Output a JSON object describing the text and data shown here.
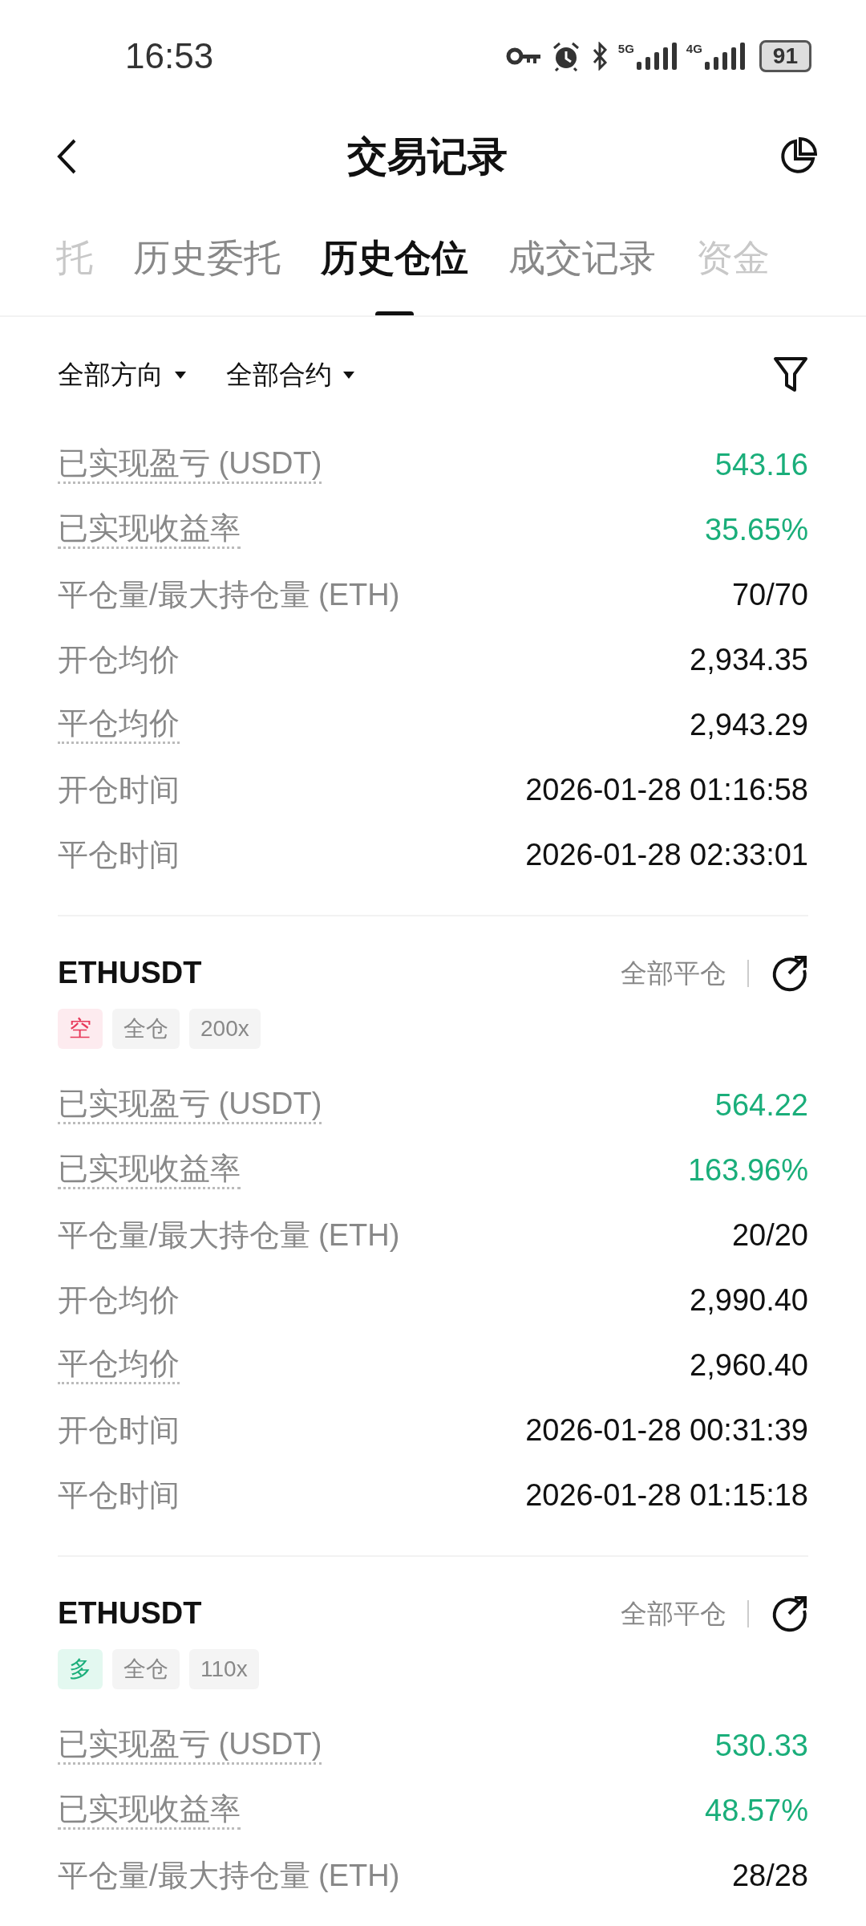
{
  "status_bar": {
    "time": "16:53",
    "network_1": "5G",
    "network_2": "4G",
    "battery": "91"
  },
  "header": {
    "title": "交易记录"
  },
  "tabs": [
    {
      "label": "托",
      "selected": false,
      "partial": true
    },
    {
      "label": "历史委托",
      "selected": false
    },
    {
      "label": "历史仓位",
      "selected": true
    },
    {
      "label": "成交记录",
      "selected": false
    },
    {
      "label": "资金",
      "selected": false,
      "partial": true
    }
  ],
  "filters": [
    {
      "label": "全部方向"
    },
    {
      "label": "全部合约"
    }
  ],
  "positions": [
    {
      "rows": [
        {
          "label": "已实现盈亏 (USDT)",
          "value": "543.16",
          "dotted": true,
          "kind": "gain"
        },
        {
          "label": "已实现收益率",
          "value": "35.65%",
          "dotted": true,
          "kind": "gain"
        },
        {
          "label": "平仓量/最大持仓量 (ETH)",
          "value": "70/70",
          "dotted": false,
          "kind": "plain"
        },
        {
          "label": "开仓均价",
          "value": "2,934.35",
          "dotted": false,
          "kind": "plain"
        },
        {
          "label": "平仓均价",
          "value": "2,943.29",
          "dotted": true,
          "kind": "plain"
        },
        {
          "label": "开仓时间",
          "value": "2026-01-28 01:16:58",
          "dotted": false,
          "kind": "plain"
        },
        {
          "label": "平仓时间",
          "value": "2026-01-28 02:33:01",
          "dotted": false,
          "kind": "plain"
        }
      ]
    },
    {
      "symbol": "ETHUSDT",
      "status": "全部平仓",
      "tags": [
        {
          "label": "空",
          "kind": "short"
        },
        {
          "label": "全仓",
          "kind": "plain"
        },
        {
          "label": "200x",
          "kind": "plain"
        }
      ],
      "rows": [
        {
          "label": "已实现盈亏 (USDT)",
          "value": "564.22",
          "dotted": true,
          "kind": "gain"
        },
        {
          "label": "已实现收益率",
          "value": "163.96%",
          "dotted": true,
          "kind": "gain"
        },
        {
          "label": "平仓量/最大持仓量 (ETH)",
          "value": "20/20",
          "dotted": false,
          "kind": "plain"
        },
        {
          "label": "开仓均价",
          "value": "2,990.40",
          "dotted": false,
          "kind": "plain"
        },
        {
          "label": "平仓均价",
          "value": "2,960.40",
          "dotted": true,
          "kind": "plain"
        },
        {
          "label": "开仓时间",
          "value": "2026-01-28 00:31:39",
          "dotted": false,
          "kind": "plain"
        },
        {
          "label": "平仓时间",
          "value": "2026-01-28 01:15:18",
          "dotted": false,
          "kind": "plain"
        }
      ]
    },
    {
      "symbol": "ETHUSDT",
      "status": "全部平仓",
      "tags": [
        {
          "label": "多",
          "kind": "long"
        },
        {
          "label": "全仓",
          "kind": "plain"
        },
        {
          "label": "110x",
          "kind": "plain"
        }
      ],
      "rows": [
        {
          "label": "已实现盈亏 (USDT)",
          "value": "530.33",
          "dotted": true,
          "kind": "gain"
        },
        {
          "label": "已实现收益率",
          "value": "48.57%",
          "dotted": true,
          "kind": "gain"
        },
        {
          "label": "平仓量/最大持仓量 (ETH)",
          "value": "28/28",
          "dotted": false,
          "kind": "plain"
        }
      ]
    }
  ]
}
